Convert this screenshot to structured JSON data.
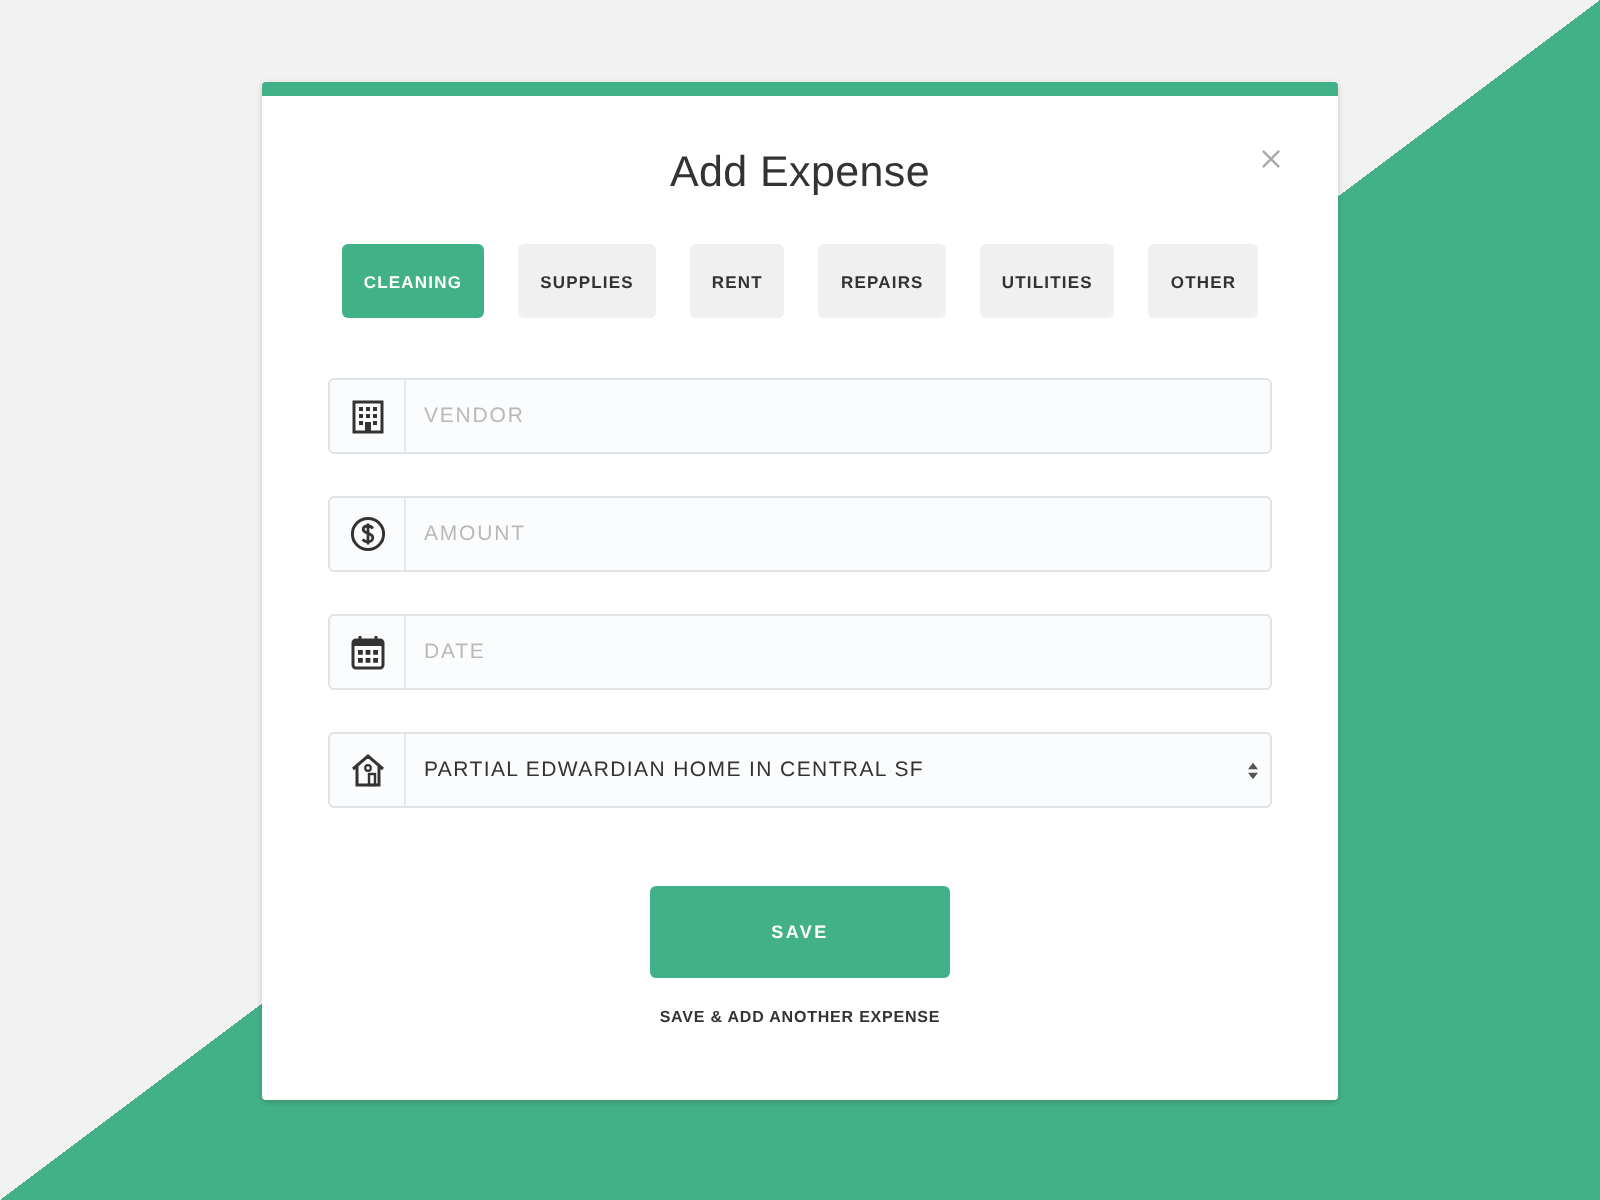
{
  "modal": {
    "title": "Add Expense"
  },
  "categories": [
    {
      "label": "CLEANING",
      "selected": true
    },
    {
      "label": "SUPPLIES",
      "selected": false
    },
    {
      "label": "RENT",
      "selected": false
    },
    {
      "label": "REPAIRS",
      "selected": false
    },
    {
      "label": "UTILITIES",
      "selected": false
    },
    {
      "label": "OTHER",
      "selected": false
    }
  ],
  "fields": [
    {
      "kind": "input",
      "placeholder": "VENDOR"
    },
    {
      "kind": "input",
      "placeholder": "AMOUNT"
    },
    {
      "kind": "input",
      "placeholder": "DATE"
    },
    {
      "kind": "select",
      "value": "PARTIAL EDWARDIAN HOME IN CENTRAL SF"
    }
  ],
  "save_button": "SAVE",
  "secondary_link": "SAVE & ADD ANOTHER EXPENSE"
}
